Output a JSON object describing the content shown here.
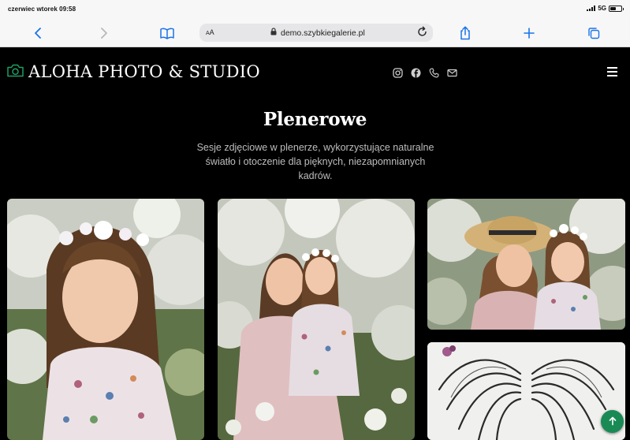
{
  "status_bar": {
    "time": "czerwiec wtorek 09:58",
    "network": "5G",
    "battery_level": 0.55
  },
  "browser": {
    "text_size_label": "AA",
    "url": "demo.szybkiegalerie.pl",
    "icons": [
      "back-icon",
      "forward-icon",
      "bookmarks-icon",
      "lock-icon",
      "reload-icon",
      "share-icon",
      "new-tab-icon",
      "tabs-icon"
    ]
  },
  "site": {
    "brand": "ALOHA PHOTO & STUDIO",
    "brand_icon": "camera-icon",
    "accent_color": "#1a8a55",
    "social_icons": [
      "instagram-icon",
      "facebook-icon",
      "phone-icon",
      "email-icon"
    ],
    "menu_icon": "hamburger-icon"
  },
  "hero": {
    "title": "Plenerowe",
    "description": "Sesje zdjęciowe w plenerze, wykorzystujące naturalne światło i otoczenie dla pięknych, niezapomnianych kadrów."
  },
  "gallery": {
    "photos": [
      "girl-flower-crown-photo",
      "mother-daughter-blossoms-photo",
      "mother-daughter-hug-photo",
      "angel-wings-mural-photo"
    ]
  },
  "scroll_top_icon": "arrow-up-icon"
}
